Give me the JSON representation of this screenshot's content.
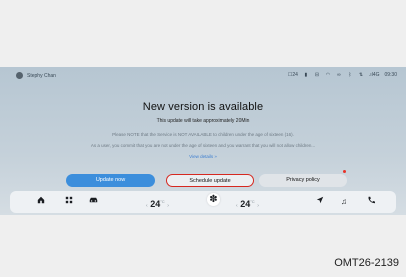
{
  "status_bar": {
    "user_name": "Stephy Chan",
    "icons": [
      "temperature-icon",
      "battery-icon",
      "bluetooth-icon",
      "wifi-icon",
      "signal-icon"
    ],
    "temperature": "24",
    "network": "4G",
    "time": "09:30"
  },
  "dialog": {
    "title": "New version is available",
    "subtitle": "This update will take approximately 20Min",
    "note_children": "Please NOTE that the Service is NOT AVAILABLE to children under the age of sixteen (16).",
    "note_confirm": "As a user, you commit that you are not under the age of sixteen and you warrant that you will not allow children...",
    "view_details": "View details »"
  },
  "buttons": {
    "update_now": "Update now",
    "schedule_update": "Schedule update",
    "privacy_policy": "Privacy policy"
  },
  "dock": {
    "left_temp": "24",
    "right_temp": "24",
    "temp_unit": "°C",
    "left_arrow": "‹",
    "right_arrow": "›",
    "items": [
      "home-icon",
      "apps-icon",
      "car-icon",
      "fan-icon",
      "navigation-icon",
      "music-icon",
      "phone-icon"
    ]
  },
  "caption": "OMT26-2139"
}
